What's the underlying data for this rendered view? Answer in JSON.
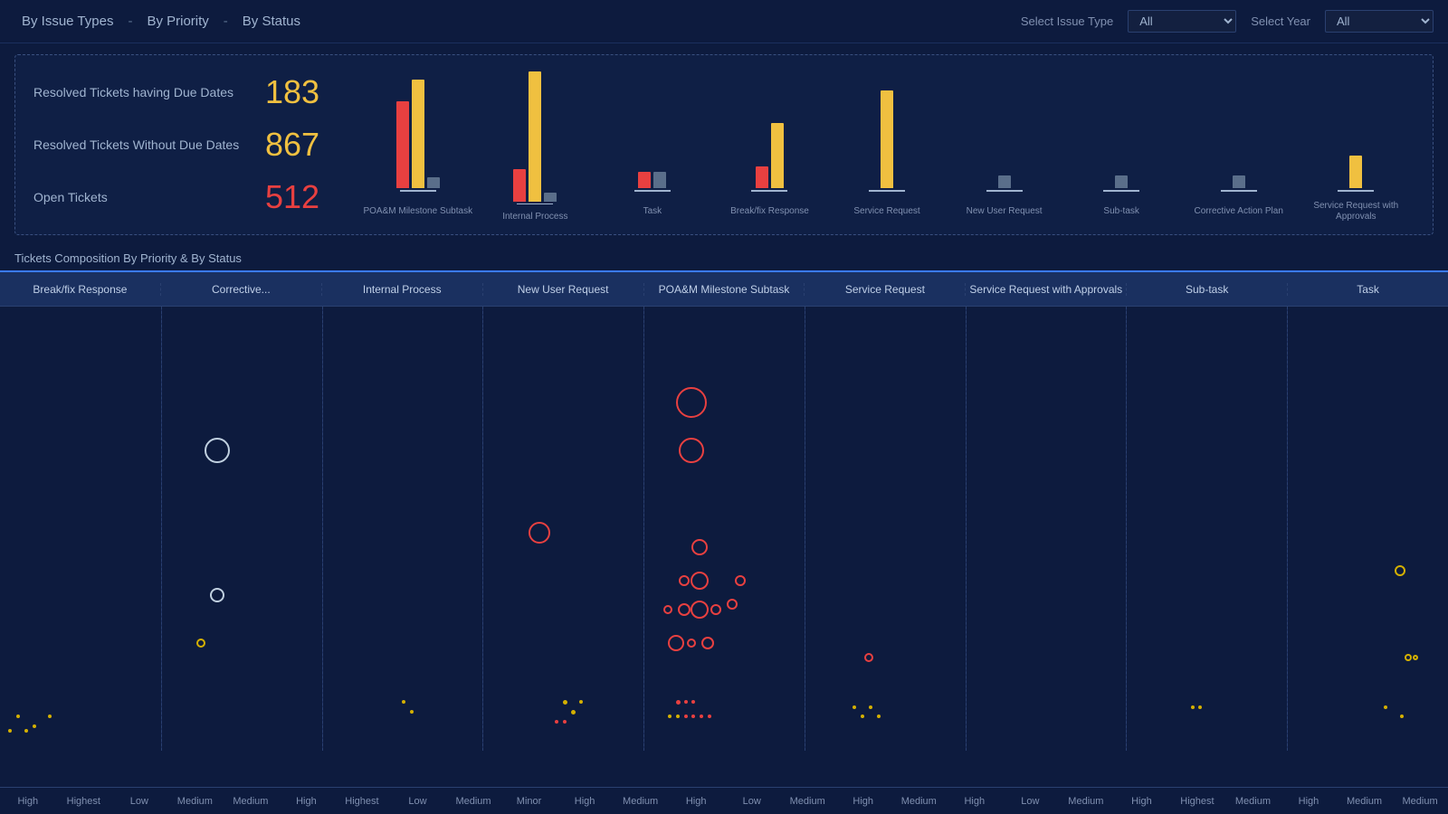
{
  "header": {
    "nav_items": [
      "By Issue Types",
      "By Priority",
      "By Status"
    ],
    "separators": [
      "-",
      "-"
    ],
    "select_issue_label": "Select Issue Type",
    "select_issue_value": "All",
    "select_year_label": "Select Year",
    "select_year_value": "All"
  },
  "summary": {
    "stat1_label": "Resolved Tickets having Due Dates",
    "stat1_value": "183",
    "stat2_label": "Resolved Tickets Without Due Dates",
    "stat2_value": "867",
    "stat3_label": "Open Tickets",
    "stat3_value": "512"
  },
  "bar_chart": {
    "groups": [
      {
        "label": "POA&M Milestone\nSubtask",
        "red": 80,
        "yellow": 100,
        "gray": 10
      },
      {
        "label": "Internal Process",
        "red": 30,
        "yellow": 120,
        "gray": 8
      },
      {
        "label": "Task",
        "red": 15,
        "yellow": 0,
        "gray": 15
      },
      {
        "label": "Break/fix Response",
        "red": 20,
        "yellow": 60,
        "gray": 0
      },
      {
        "label": "Service Request",
        "red": 0,
        "yellow": 90,
        "gray": 0
      },
      {
        "label": "New User Request",
        "red": 0,
        "yellow": 0,
        "gray": 12
      },
      {
        "label": "Sub-task",
        "red": 0,
        "yellow": 0,
        "gray": 12
      },
      {
        "label": "Corrective Action\nPlan",
        "red": 0,
        "yellow": 0,
        "gray": 12
      },
      {
        "label": "Service Request\nwith Approvals",
        "red": 0,
        "yellow": 30,
        "gray": 0
      }
    ]
  },
  "scatter": {
    "section_title": "Tickets Composition By Priority & By Status",
    "columns": [
      "Break/fix Response",
      "Corrective...",
      "Internal Process",
      "New User Request",
      "POA&M Milestone Subtask",
      "Service Request",
      "Service Request with Approvals",
      "Sub-task",
      "Task"
    ],
    "x_axis_labels": [
      "High",
      "Highest",
      "Low",
      "Medium",
      "Medium",
      "High",
      "Highest",
      "Low",
      "Medium",
      "Minor",
      "High",
      "Medium",
      "High",
      "Low",
      "Medium",
      "High",
      "Medium",
      "High",
      "Low",
      "Medium",
      "High",
      "Highest",
      "Medium",
      "High",
      "Medium",
      "Medium"
    ]
  }
}
